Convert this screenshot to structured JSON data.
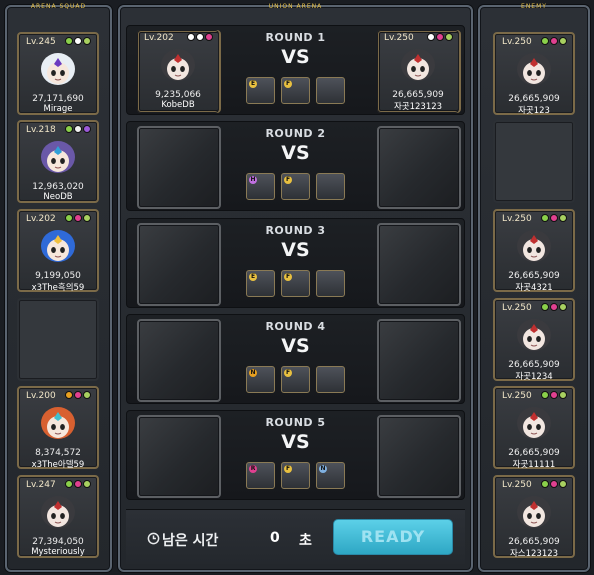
{
  "titles": {
    "left": "ARENA SQUAD",
    "center": "UNION ARENA",
    "right": "ENEMY"
  },
  "squad": [
    {
      "level": "Lv.245",
      "power": "27,171,690",
      "name": "Mirage",
      "badges": [
        "#8ad04a",
        "#ffffff",
        "#a8d060"
      ],
      "avatar": "white-hair-avatar"
    },
    {
      "level": "Lv.218",
      "power": "12,963,020",
      "name": "NeoDB",
      "badges": [
        "#8ad04a",
        "#f2f2f2",
        "#9c5ad8"
      ],
      "avatar": "purple-hair-avatar"
    },
    {
      "level": "Lv.202",
      "power": "9,199,050",
      "name": "x3The흑의59",
      "badges": [
        "#8ad04a",
        "#e04090",
        "#a8d060"
      ],
      "avatar": "blue-hat-avatar"
    },
    null,
    {
      "level": "Lv.200",
      "power": "8,374,572",
      "name": "x3The아델59",
      "badges": [
        "#e8a020",
        "#e04090",
        "#a8d060"
      ],
      "avatar": "colorful-hat-avatar"
    },
    {
      "level": "Lv.247",
      "power": "27,394,050",
      "name": "Mysteriously",
      "badges": [
        "#8ad04a",
        "#e04090",
        "#a8d060"
      ],
      "avatar": "hooded-avatar"
    }
  ],
  "enemy": [
    {
      "level": "Lv.250",
      "power": "26,665,909",
      "name": "자곳123",
      "badges": [
        "#8ad04a",
        "#e04090",
        "#a8d060"
      ],
      "avatar": "hooded-avatar"
    },
    null,
    {
      "level": "Lv.250",
      "power": "26,665,909",
      "name": "자곳4321",
      "badges": [
        "#8ad04a",
        "#e04090",
        "#a8d060"
      ],
      "avatar": "hooded-avatar"
    },
    {
      "level": "Lv.250",
      "power": "26,665,909",
      "name": "자곳1234",
      "badges": [
        "#8ad04a",
        "#e04090",
        "#a8d060"
      ],
      "avatar": "hooded-avatar"
    },
    {
      "level": "Lv.250",
      "power": "26,665,909",
      "name": "자곳11111",
      "badges": [
        "#8ad04a",
        "#e04090",
        "#a8d060"
      ],
      "avatar": "hooded-avatar"
    },
    {
      "level": "Lv.250",
      "power": "26,665,909",
      "name": "자스123123",
      "badges": [
        "#8ad04a",
        "#e04090",
        "#a8d060"
      ],
      "avatar": "hooded-avatar"
    }
  ],
  "rounds": [
    {
      "label": "ROUND 1",
      "vs": "VS",
      "left": {
        "level": "Lv.202",
        "power": "9,235,066",
        "name": "KobeDB",
        "badges": [
          "#ffffff",
          "#ffffff",
          "#e04090"
        ]
      },
      "right": {
        "level": "Lv.250",
        "power": "26,665,909",
        "name": "자곳123123",
        "badges": [
          "#ffffff",
          "#e04090",
          "#a8d060"
        ]
      },
      "chars": [
        {
          "tag": "E",
          "color": "#e8c040"
        },
        {
          "tag": "F",
          "color": "#e8c040"
        },
        {
          "tag": "",
          "color": "#7fb0e0"
        }
      ]
    },
    {
      "label": "ROUND 2",
      "vs": "VS",
      "left": null,
      "right": null,
      "chars": [
        {
          "tag": "H",
          "color": "#c070e0"
        },
        {
          "tag": "F",
          "color": "#e8c040"
        },
        {
          "tag": "",
          "color": "#7fb0e0"
        }
      ]
    },
    {
      "label": "ROUND 3",
      "vs": "VS",
      "left": null,
      "right": null,
      "chars": [
        {
          "tag": "E",
          "color": "#e8c040"
        },
        {
          "tag": "F",
          "color": "#e8c040"
        },
        {
          "tag": "",
          "color": "#7fb0e0"
        }
      ]
    },
    {
      "label": "ROUND 4",
      "vs": "VS",
      "left": null,
      "right": null,
      "chars": [
        {
          "tag": "N",
          "color": "#e8a020"
        },
        {
          "tag": "F",
          "color": "#e8c040"
        },
        {
          "tag": "",
          "color": "#7fb0e0"
        }
      ]
    },
    {
      "label": "ROUND 5",
      "vs": "VS",
      "left": null,
      "right": null,
      "chars": [
        {
          "tag": "R",
          "color": "#e04090"
        },
        {
          "tag": "F",
          "color": "#e8c040"
        },
        {
          "tag": "N",
          "color": "#7fb0e0"
        }
      ]
    }
  ],
  "timer": {
    "label": "남은 시간",
    "value": "0",
    "unit": "초"
  },
  "ready_label": "READY"
}
